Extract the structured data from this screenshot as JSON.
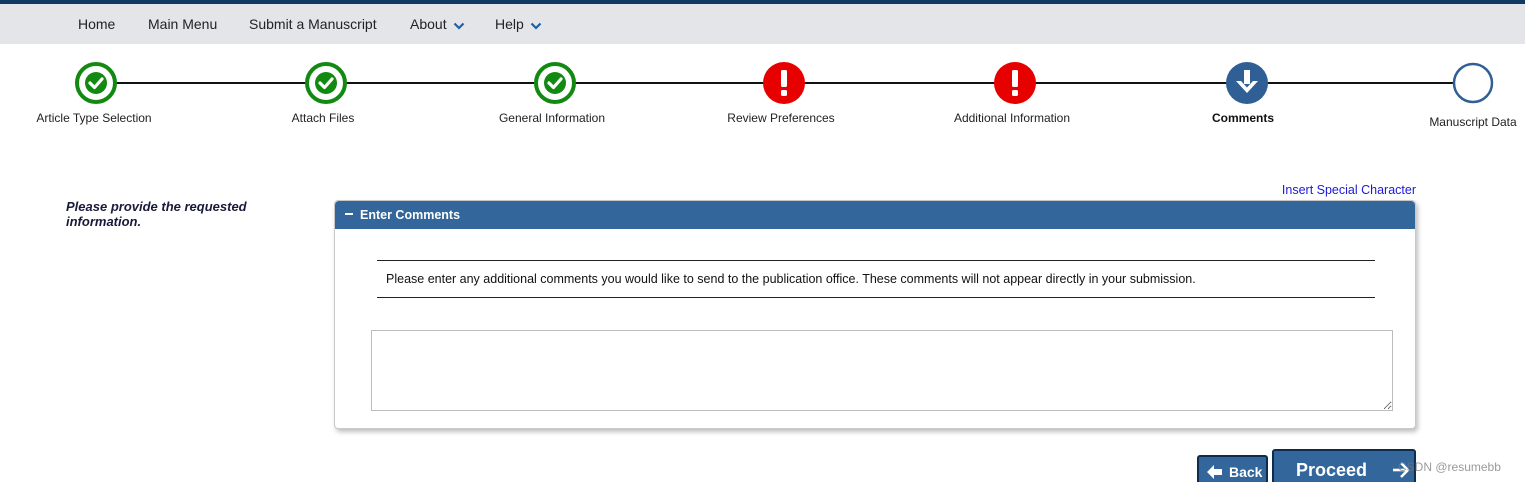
{
  "nav": {
    "items": [
      {
        "label": "Home"
      },
      {
        "label": "Main Menu"
      },
      {
        "label": "Submit a Manuscript"
      },
      {
        "label": "About"
      },
      {
        "label": "Help"
      }
    ]
  },
  "steps": [
    {
      "label": "Article Type Selection",
      "status": "complete"
    },
    {
      "label": "Attach Files",
      "status": "complete"
    },
    {
      "label": "General Information",
      "status": "complete"
    },
    {
      "label": "Review Preferences",
      "status": "error"
    },
    {
      "label": "Additional Information",
      "status": "error"
    },
    {
      "label": "Comments",
      "status": "current"
    },
    {
      "label": "Manuscript Data",
      "status": "pending"
    }
  ],
  "side_message": "Please provide the requested information.",
  "special_char_link": "Insert Special Character",
  "panel": {
    "title": "Enter Comments",
    "instructions": "Please enter any additional comments you would like to send to the publication office. These comments will not appear directly in your submission.",
    "comments_value": ""
  },
  "buttons": {
    "back": "Back",
    "proceed": "Proceed"
  },
  "watermark": "CSDN @resumebb",
  "colors": {
    "nav_bg": "#e3e5e8",
    "accent_blue": "#33669a",
    "complete_green": "#128a12",
    "error_red": "#e60000",
    "link_blue": "#1a1ad4"
  }
}
